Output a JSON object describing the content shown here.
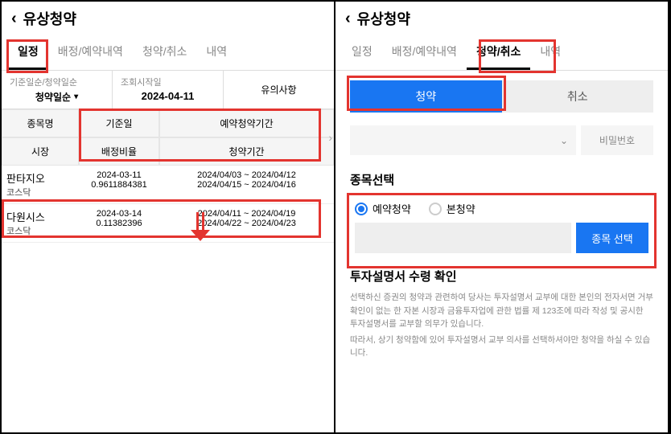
{
  "left": {
    "title": "유상청약",
    "tabs": [
      "일정",
      "배정/예약내역",
      "청약/취소",
      "내역"
    ],
    "activeTab": 0,
    "filters": {
      "sortLabel": "기준일순/청약일순",
      "sortValue": "청약일순",
      "dateLabel": "조회시작일",
      "dateValue": "2024-04-11",
      "notice": "유의사항"
    },
    "headers": {
      "col1a": "종목명",
      "col1b": "시장",
      "col2a": "기준일",
      "col2b": "배정비율",
      "col3a": "예약청약기간",
      "col3b": "청약기간"
    },
    "rows": [
      {
        "name": "판타지오",
        "market": "코스닥",
        "baseDate": "2024-03-11",
        "ratio": "0.9611884381",
        "reserve": "2024/04/03  ~  2024/04/12",
        "sub": "2024/04/15  ~  2024/04/16"
      },
      {
        "name": "다원시스",
        "market": "코스닥",
        "baseDate": "2024-03-14",
        "ratio": "0.11382396",
        "reserve": "2024/04/11  ~  2024/04/19",
        "sub": "2024/04/22  ~  2024/04/23"
      }
    ]
  },
  "right": {
    "title": "유상청약",
    "tabs": [
      "일정",
      "배정/예약내역",
      "청약/취소",
      "내역"
    ],
    "activeTab": 2,
    "segments": {
      "sub": "청약",
      "cancel": "취소"
    },
    "pwPlaceholder": "비밀번호",
    "stockTitle": "종목선택",
    "radios": {
      "reserve": "예약청약",
      "main": "본청약"
    },
    "selectBtn": "종목 선택",
    "disclosure": {
      "title": "투자설명서 수령 확인",
      "p1": "선택하신 증권의 청약과 관련하여 당사는 투자설명서 교부에 대한 본인의 전자서면 거부 확인이 없는 한 자본 시장과 금융투자업에 관한 법률 제 123조에 따라 작성 및 공시한 투자설명서를 교부할 의무가 있습니다.",
      "p2": "따라서, 상기 청약함에 있어 투자설명서 교부 의사를 선택하셔야만 청약을 하실 수 있습니다."
    }
  }
}
